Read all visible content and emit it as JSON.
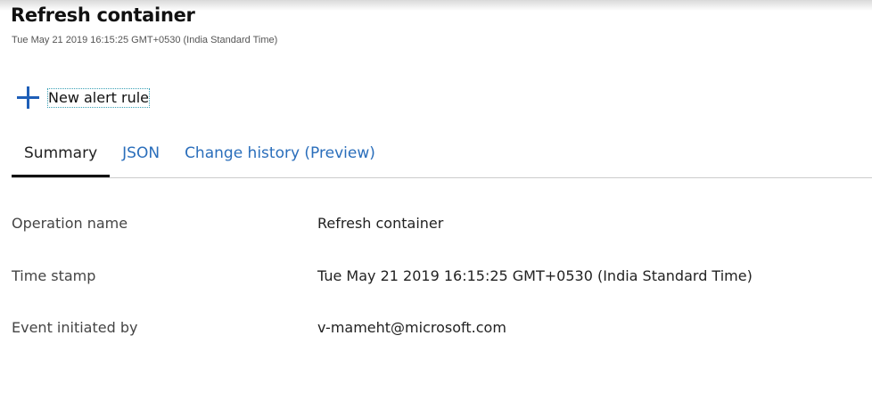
{
  "header": {
    "title": "Refresh container",
    "subtitle": "Tue May 21 2019 16:15:25 GMT+0530 (India Standard Time)"
  },
  "toolbar": {
    "new_alert_rule_label": "New alert rule",
    "new_alert_rule_icon": "plus-icon"
  },
  "tabs": [
    {
      "label": "Summary",
      "active": true
    },
    {
      "label": "JSON",
      "active": false
    },
    {
      "label": "Change history (Preview)",
      "active": false
    }
  ],
  "summary": [
    {
      "label": "Operation name",
      "value": "Refresh container"
    },
    {
      "label": "Time stamp",
      "value": "Tue May 21 2019 16:15:25 GMT+0530 (India Standard Time)"
    },
    {
      "label": "Event initiated by",
      "value": "v-mameht@microsoft.com"
    }
  ],
  "colors": {
    "accent": "#1e5fb8",
    "link": "#2a6ebb"
  }
}
